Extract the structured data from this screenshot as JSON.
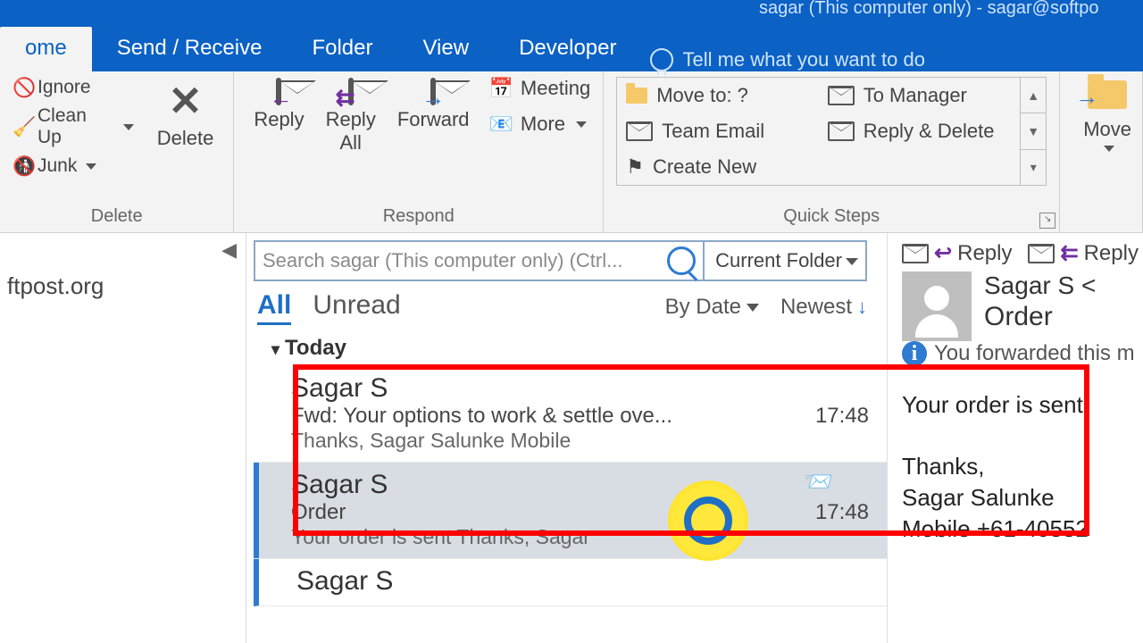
{
  "title_suffix": "sagar (This computer only) - sagar@softpo",
  "tabs": {
    "home": "ome",
    "send": "Send / Receive",
    "folder": "Folder",
    "view": "View",
    "dev": "Developer"
  },
  "tellme": "Tell me what you want to do",
  "ribbon": {
    "delete": {
      "ignore": "Ignore",
      "clean": "Clean Up",
      "junk": "Junk",
      "delete": "Delete",
      "group": "Delete"
    },
    "respond": {
      "reply": "Reply",
      "reply_all": "Reply\nAll",
      "forward": "Forward",
      "meeting": "Meeting",
      "more": "More",
      "group": "Respond"
    },
    "quicksteps": {
      "items_l": [
        "Move to: ?",
        "Team Email",
        "Create New"
      ],
      "items_r": [
        "To Manager",
        "Reply & Delete"
      ],
      "group": "Quick Steps"
    },
    "move": {
      "label": "Move"
    }
  },
  "nav": {
    "account": "ftpost.org"
  },
  "search": {
    "placeholder": "Search sagar (This computer only) (Ctrl...",
    "scope": "Current Folder"
  },
  "filter": {
    "all": "All",
    "unread": "Unread",
    "sort": "By Date",
    "dir": "Newest"
  },
  "group_today": "Today",
  "messages": [
    {
      "from": "Sagar S",
      "subject": "Fwd: Your options to work & settle ove...",
      "preview": "Thanks,   Sagar Salunke   Mobile",
      "time": "17:48"
    },
    {
      "from": "Sagar S",
      "subject": "Order",
      "preview": "Your order is sent   Thanks,   Sagar",
      "time": "17:48"
    },
    {
      "from": "Sagar S",
      "subject": "",
      "preview": "",
      "time": ""
    }
  ],
  "reading": {
    "reply": "Reply",
    "reply_all": "Reply All",
    "from": "Sagar S <",
    "subject": "Order",
    "info": "You forwarded this m",
    "body_line": "Your order is sent",
    "sig1": "Thanks,",
    "sig2": "Sagar Salunke",
    "sig3": "Mobile +61-40552"
  }
}
